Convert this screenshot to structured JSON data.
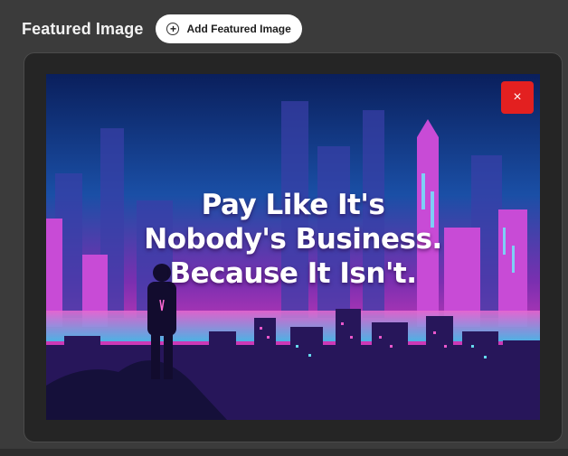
{
  "featured_image": {
    "title": "Featured Image",
    "add_button_label": "Add Featured Image",
    "add_icon": "plus-circle-icon",
    "remove_icon": "close-icon",
    "remove_symbol": "×",
    "headline_lines": [
      "Pay Like It's",
      "Nobody's Business.",
      "Because It Isn't."
    ],
    "colors": {
      "panel_bg": "#3b3b3b",
      "frame_bg": "#252525",
      "remove_button": "#e32020",
      "add_button_bg": "#ffffff"
    }
  }
}
